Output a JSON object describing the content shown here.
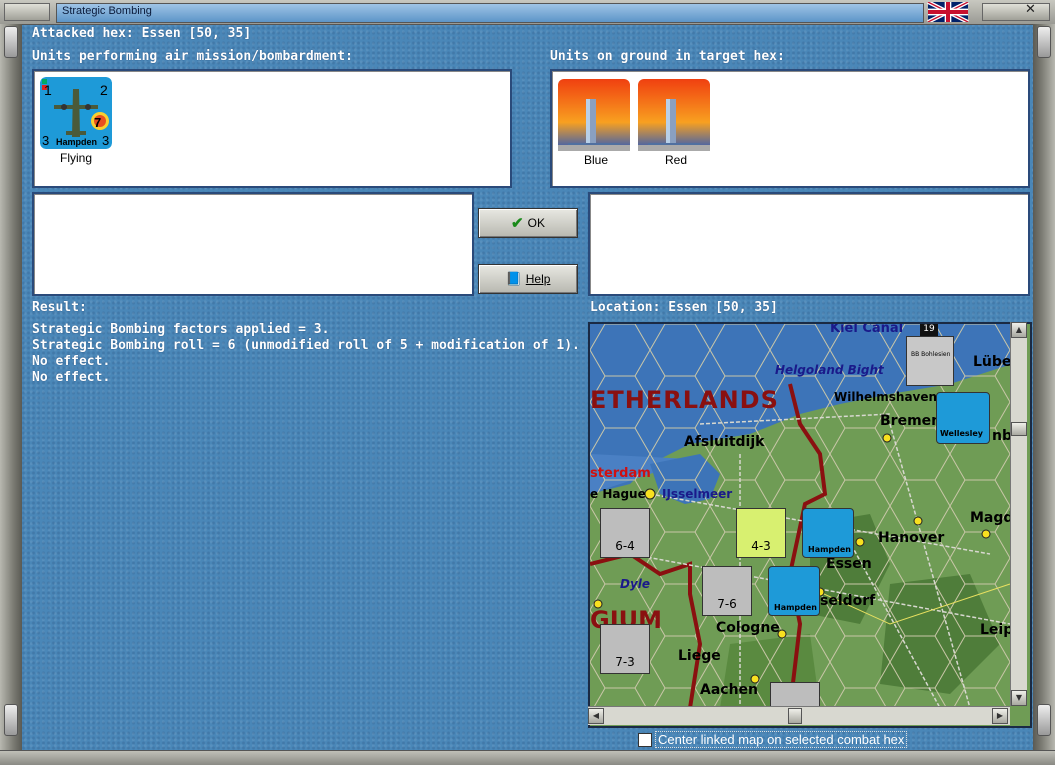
{
  "window": {
    "title": "Strategic Bombing"
  },
  "attacked_hex": "Attacked hex: Essen  [50, 35]",
  "air_panel": {
    "header": "Units performing air mission/bombardment:",
    "units": [
      {
        "name": "Hampden",
        "top_left": "1",
        "top_right": "2",
        "bottom_left": "3",
        "bottom_right": "3",
        "badge": "7",
        "status": "Flying"
      }
    ]
  },
  "ground_panel": {
    "header": "Units on ground in target hex:",
    "units": [
      {
        "status": "Blue"
      },
      {
        "status": "Red"
      }
    ]
  },
  "buttons": {
    "ok": "OK",
    "help": "Help"
  },
  "result": {
    "header": "Result:",
    "lines": [
      "Strategic Bombing factors applied = 3.",
      "Strategic Bombing roll = 6 (unmodified roll of 5 + modification of 1).",
      "No effect.",
      "No effect."
    ]
  },
  "location": {
    "header": "Location:  Essen  [50, 35]",
    "map_labels": {
      "kiel": "Kiel Canal",
      "helgoland": "Helgoland Bight",
      "wilhelmshaven": "Wilhelmshaven",
      "bremen": "Bremen",
      "lubeck": "Lübe",
      "netherlands": "ETHERLANDS",
      "afsluitdijk": "Afsluitdijk",
      "amsterdam": "sterdam",
      "hague": "e Hague",
      "ijsselmeer": "IJsselmeer",
      "hanover": "Hanover",
      "magd": "Magd",
      "essen": "Essen",
      "dusseldorf": "seldorf",
      "dyle": "Dyle",
      "belgium": "GIUM",
      "cologne": "Cologne",
      "liege": "Liege",
      "aachen": "Aachen",
      "leip": "Leip",
      "hamb": "nb"
    },
    "map_units": {
      "u1": "6-4",
      "u2": "4-3",
      "u3": "7-6",
      "u4": "7-3",
      "h1": "Hampden",
      "h2": "Hampden",
      "w1": "Wellesley",
      "bb": "BB Bohlesien",
      "r19": "19"
    }
  },
  "checkbox": {
    "label": "Center linked map on selected combat hex",
    "checked": false
  },
  "colors": {
    "accent": "#2a4a7a",
    "sea": "#3d74b8",
    "land": "#6f9c55",
    "border_red": "#8a1010"
  }
}
